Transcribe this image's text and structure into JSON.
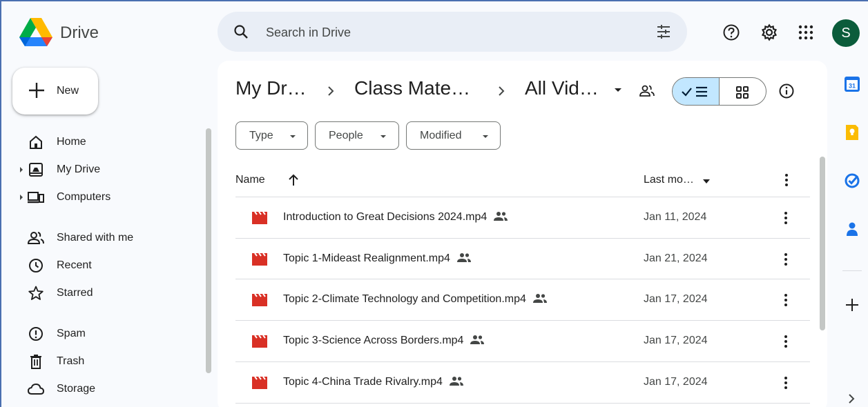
{
  "app": {
    "brand": "Drive"
  },
  "search": {
    "placeholder": "Search in Drive"
  },
  "header": {
    "avatar_letter": "S"
  },
  "sidebar": {
    "new_label": "New",
    "items": [
      {
        "label": "Home",
        "icon": "home-icon"
      },
      {
        "label": "My Drive",
        "icon": "my-drive-icon"
      },
      {
        "label": "Computers",
        "icon": "computers-icon"
      },
      {
        "label": "Shared with me",
        "icon": "shared-icon"
      },
      {
        "label": "Recent",
        "icon": "clock-icon"
      },
      {
        "label": "Starred",
        "icon": "star-icon"
      },
      {
        "label": "Spam",
        "icon": "spam-icon"
      },
      {
        "label": "Trash",
        "icon": "trash-icon"
      },
      {
        "label": "Storage",
        "icon": "cloud-icon"
      }
    ]
  },
  "breadcrumb": [
    "My Dr…",
    "Class Mate…",
    "All Vid…"
  ],
  "filters": [
    "Type",
    "People",
    "Modified"
  ],
  "table": {
    "col_name": "Name",
    "col_modified": "Last mo…",
    "rows": [
      {
        "name": "Introduction to Great Decisions 2024.mp4",
        "date": "Jan 11, 2024"
      },
      {
        "name": "Topic 1-Mideast Realignment.mp4",
        "date": "Jan 21, 2024"
      },
      {
        "name": "Topic 2-Climate Technology and Competition.mp4",
        "date": "Jan 17, 2024"
      },
      {
        "name": "Topic 3-Science Across Borders.mp4",
        "date": "Jan 17, 2024"
      },
      {
        "name": "Topic 4-China Trade Rivalry.mp4",
        "date": "Jan 17, 2024"
      }
    ]
  },
  "side_panel": {
    "calendar_day": "31"
  },
  "colors": {
    "accent": "#0b57d0",
    "selected": "#c2e7ff",
    "avatar": "#0b5c3b",
    "video": "#d93025"
  }
}
